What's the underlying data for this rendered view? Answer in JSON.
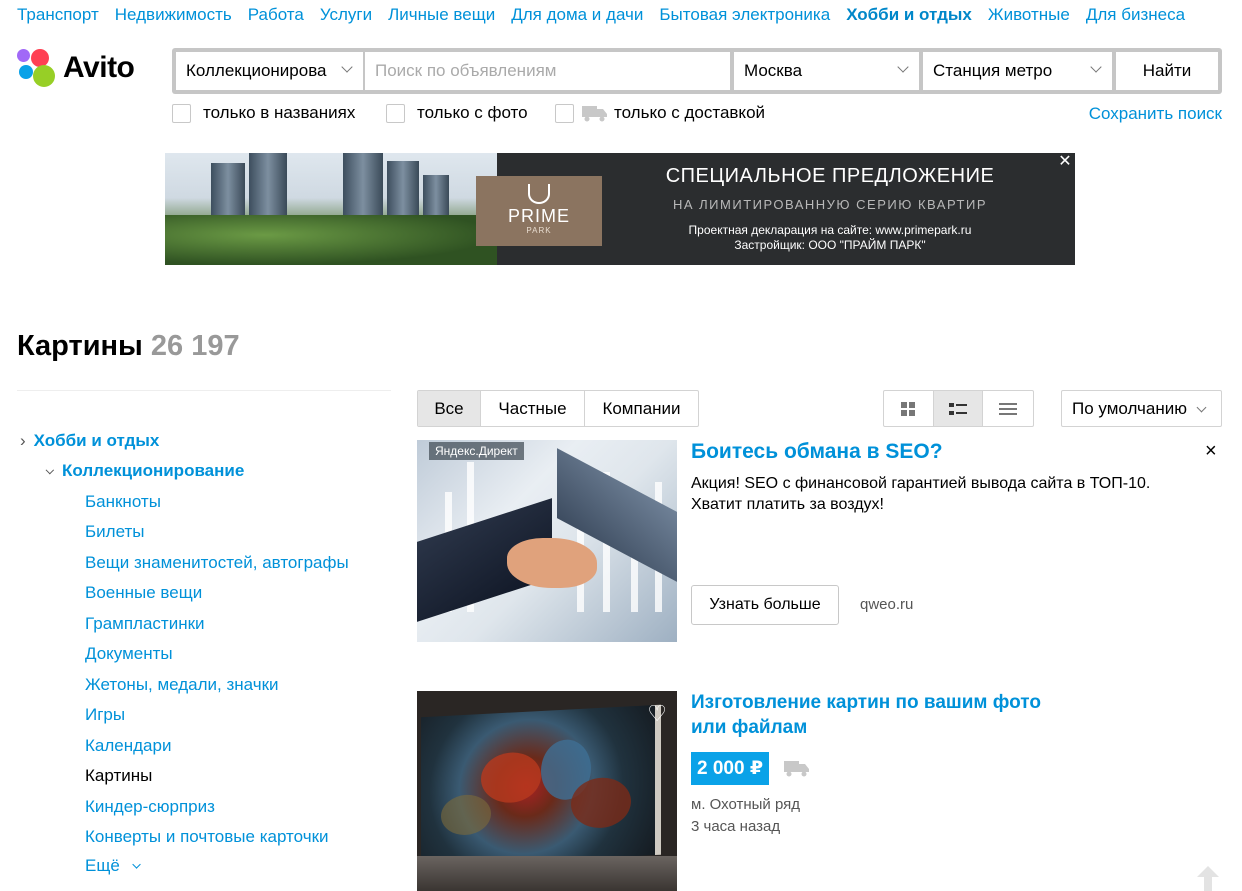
{
  "topnav": [
    "Транспорт",
    "Недвижимость",
    "Работа",
    "Услуги",
    "Личные вещи",
    "Для дома и дачи",
    "Бытовая электроника",
    "Хобби и отдых",
    "Животные",
    "Для бизнеса"
  ],
  "topnav_active": "Хобби и отдых",
  "logo": {
    "text": "Avito"
  },
  "search": {
    "category": "Коллекционирова",
    "query_placeholder": "Поиск по объявлениям",
    "city": "Москва",
    "metro": "Станция метро",
    "find_label": "Найти"
  },
  "filters": {
    "titles_only": "только в названиях",
    "photo_only": "только с фото",
    "delivery_only": "только с доставкой",
    "save_search": "Сохранить поиск"
  },
  "banner": {
    "brand": "PRIME",
    "brand_sub": "PARK",
    "title": "СПЕЦИАЛЬНОЕ ПРЕДЛОЖЕНИЕ",
    "subtitle": "НА ЛИМИТИРОВАННУЮ СЕРИЮ КВАРТИР",
    "declaration_1": "Проектная декларация на сайте: www.primepark.ru",
    "declaration_2": "Застройщик: ООО \"ПРАЙМ ПАРК\"",
    "close": "✕"
  },
  "page": {
    "title": "Картины",
    "count": "26 197"
  },
  "sidebar": {
    "root": "Хобби и отдых",
    "parent": "Коллекционирование",
    "items": [
      "Банкноты",
      "Билеты",
      "Вещи знаменитостей, автографы",
      "Военные вещи",
      "Грампластинки",
      "Документы",
      "Жетоны, медали, значки",
      "Игры",
      "Календари",
      "Картины",
      "Киндер-сюрприз",
      "Конверты и почтовые карточки"
    ],
    "current": "Картины",
    "more": "Ещё"
  },
  "tabs": [
    "Все",
    "Частные",
    "Компании"
  ],
  "tabs_active": "Все",
  "sort": {
    "selected": "По умолчанию"
  },
  "ad": {
    "label": "Яндекс.Директ",
    "title": "Боитесь обмана в SEO?",
    "text_1": "Акция! SEO с финансовой гарантией вывода сайта в ТОП-10.",
    "text_2": "Хватит платить за воздух!",
    "button": "Узнать больше",
    "domain": "qweo.ru",
    "close": "×"
  },
  "listing": {
    "title_1": "Изготовление картин по вашим фото",
    "title_2": "или файлам",
    "price": "2 000 ₽",
    "metro": "м. Охотный ряд",
    "time": "3 часа назад"
  },
  "colors": {
    "link": "#0091d9",
    "price_bg": "#0aa2e8",
    "logo_red": "#ff4053",
    "logo_blue": "#0aa2e8",
    "logo_green": "#97cf26",
    "logo_purple": "#a169f7"
  }
}
